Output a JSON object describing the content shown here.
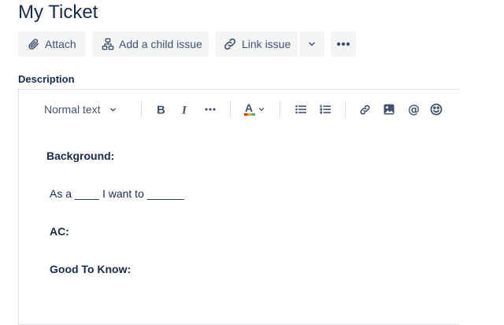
{
  "page": {
    "title": "My Ticket"
  },
  "actions": {
    "attach": "Attach",
    "add_child": "Add a child issue",
    "link_issue": "Link issue"
  },
  "description": {
    "label": "Description",
    "toolbar": {
      "text_style": "Normal text"
    },
    "content": {
      "background": "Background:",
      "story": "As a ____ I want to ______",
      "ac": "AC:",
      "good_to_know": "Good To Know:"
    }
  },
  "colors": {
    "text": "#172b4d",
    "icon": "#42526e",
    "button_bg": "#f4f5f7",
    "border": "#dfe1e6"
  }
}
